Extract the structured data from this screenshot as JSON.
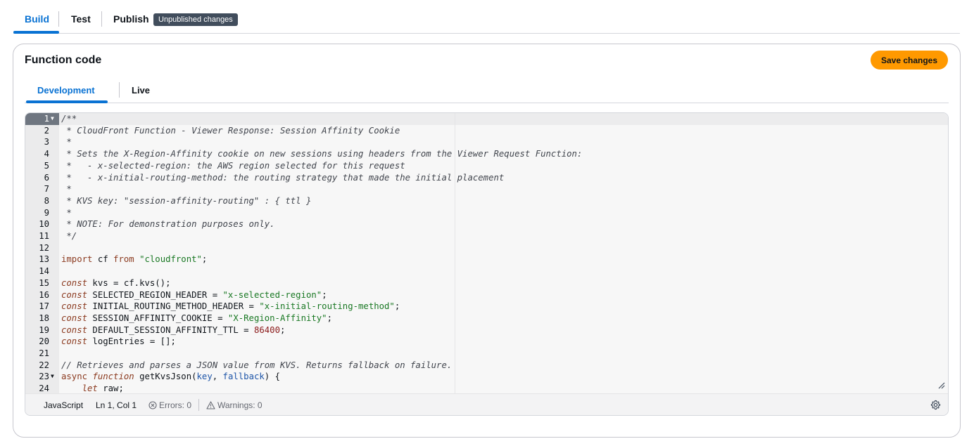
{
  "top_tabs": {
    "build": "Build",
    "test": "Test",
    "publish": "Publish",
    "badge": "Unpublished changes"
  },
  "card": {
    "title": "Function code",
    "save_label": "Save changes",
    "tabs": {
      "development": "Development",
      "live": "Live"
    }
  },
  "editor": {
    "lines": [
      {
        "n": "1",
        "t": "/**"
      },
      {
        "n": "2",
        "t": " * CloudFront Function - Viewer Response: Session Affinity Cookie"
      },
      {
        "n": "3",
        "t": " *"
      },
      {
        "n": "4",
        "t": " * Sets the X-Region-Affinity cookie on new sessions using headers from the Viewer Request Function:"
      },
      {
        "n": "5",
        "t": " *   - x-selected-region: the AWS region selected for this request"
      },
      {
        "n": "6",
        "t": " *   - x-initial-routing-method: the routing strategy that made the initial placement"
      },
      {
        "n": "7",
        "t": " *"
      },
      {
        "n": "8",
        "t": " * KVS key: \"session-affinity-routing\" : { ttl }"
      },
      {
        "n": "9",
        "t": " *"
      },
      {
        "n": "10",
        "t": " * NOTE: For demonstration purposes only."
      },
      {
        "n": "11",
        "t": " */"
      },
      {
        "n": "12",
        "t": ""
      },
      {
        "n": "13",
        "t": "import cf from \"cloudfront\";"
      },
      {
        "n": "14",
        "t": ""
      },
      {
        "n": "15",
        "t": "const kvs = cf.kvs();"
      },
      {
        "n": "16",
        "t": "const SELECTED_REGION_HEADER = \"x-selected-region\";"
      },
      {
        "n": "17",
        "t": "const INITIAL_ROUTING_METHOD_HEADER = \"x-initial-routing-method\";"
      },
      {
        "n": "18",
        "t": "const SESSION_AFFINITY_COOKIE = \"X-Region-Affinity\";"
      },
      {
        "n": "19",
        "t": "const DEFAULT_SESSION_AFFINITY_TTL = 86400;"
      },
      {
        "n": "20",
        "t": "const logEntries = [];"
      },
      {
        "n": "21",
        "t": ""
      },
      {
        "n": "22",
        "t": "// Retrieves and parses a JSON value from KVS. Returns fallback on failure."
      },
      {
        "n": "23",
        "t": "async function getKvsJson(key, fallback) {"
      },
      {
        "n": "24",
        "t": "    let raw;"
      }
    ]
  },
  "status_bar": {
    "language": "JavaScript",
    "cursor": "Ln 1, Col 1",
    "errors": "Errors: 0",
    "warnings": "Warnings: 0"
  },
  "colors": {
    "accent": "#0972d3",
    "primary_button": "#ff9900",
    "badge_bg": "#414d5c"
  },
  "icons": [
    "fold-arrow-icon",
    "error-circle-icon",
    "warning-triangle-icon",
    "resize-handle-icon",
    "gear-icon"
  ]
}
